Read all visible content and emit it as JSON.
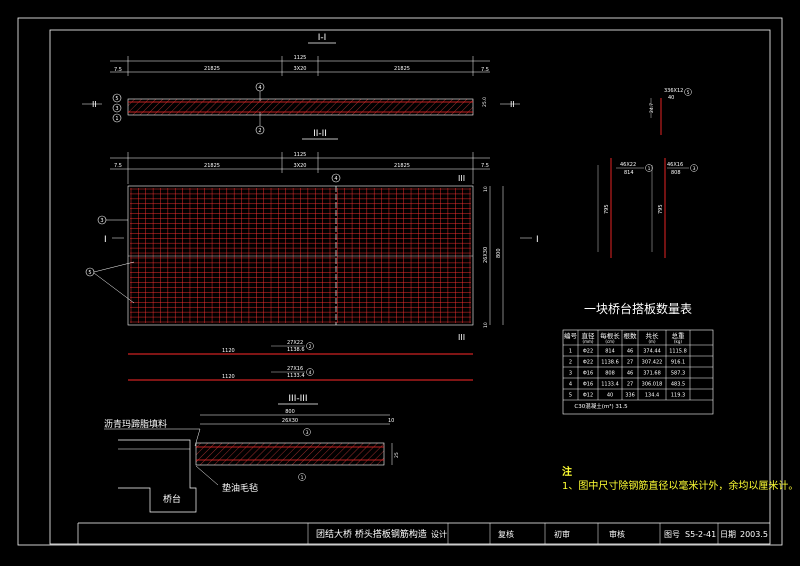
{
  "colors": {
    "bg": "#000000",
    "line": "#ffffff",
    "rebar": "#ff2a2a",
    "tag": "#ffff33",
    "grid": "#ff3333"
  },
  "sections": {
    "s1": {
      "title": "I-I",
      "cut_label": "II",
      "total": "1125",
      "edge": "7.5",
      "seg_left": "21825",
      "seg_mid": "3X20",
      "seg_right": "21825",
      "thickness": "25.0"
    },
    "s2": {
      "title": "II-II",
      "cut_label": "I",
      "side_label": "III",
      "total": "1125",
      "edge": "7.5",
      "seg_left": "21825",
      "seg_mid": "3X20",
      "seg_right": "21825",
      "height": "800",
      "inner_height": "26X30",
      "edge_v": "10"
    },
    "s3": {
      "title": "III-III",
      "width": "800",
      "inner": "26X30",
      "edge": "10",
      "height": "25",
      "label_asphalt": "沥青玛蹄脂填料",
      "label_felt": "垫油毛毡",
      "label_abutment": "桥台"
    }
  },
  "bars": [
    {
      "len": "1120",
      "top": "27X22",
      "bottom": "1138.6",
      "id": "2"
    },
    {
      "len": "1120",
      "top": "27X16",
      "bottom": "1133.4",
      "id": "4"
    }
  ],
  "details": [
    {
      "top": "336X12",
      "bottom": "40",
      "id": "5",
      "dim": "24.7"
    },
    {
      "top": "46X22",
      "bottom": "814",
      "id": "1",
      "dim": "795"
    },
    {
      "top": "46X16",
      "bottom": "808",
      "id": "3",
      "dim": "795"
    }
  ],
  "markers": [
    "1",
    "2",
    "3",
    "4",
    "5"
  ],
  "table": {
    "title": "一块桥台搭板数量表",
    "headers": [
      "编号",
      "直径",
      "每根长",
      "根数",
      "共长",
      "总重"
    ],
    "subheaders": [
      "",
      "(mm)",
      "(cm)",
      "",
      "(m)",
      "(kg)"
    ],
    "rows": [
      [
        "1",
        "Φ22",
        "814",
        "46",
        "374.44",
        "1115.8"
      ],
      [
        "2",
        "Φ22",
        "1138.6",
        "27",
        "307.422",
        "916.1"
      ],
      [
        "3",
        "Φ16",
        "808",
        "46",
        "371.68",
        "587.3"
      ],
      [
        "4",
        "Φ16",
        "1133.4",
        "27",
        "306.018",
        "483.5"
      ],
      [
        "5",
        "Φ12",
        "40",
        "336",
        "134.4",
        "119.3"
      ]
    ],
    "footer": "C30混凝土(m³) 31.5"
  },
  "notes": {
    "title": "注",
    "line1": "1、图中尺寸除钢筋直径以毫米计外，余均以厘米计。"
  },
  "titleblock": {
    "project": "团结大桥 桥头搭板钢筋构造",
    "design": "设计",
    "review": "复核",
    "check": "初审",
    "approve": "审核",
    "drawing_no_label": "图号",
    "drawing_no": "S5-2-41",
    "date_label": "日期",
    "date": "2003.5"
  }
}
